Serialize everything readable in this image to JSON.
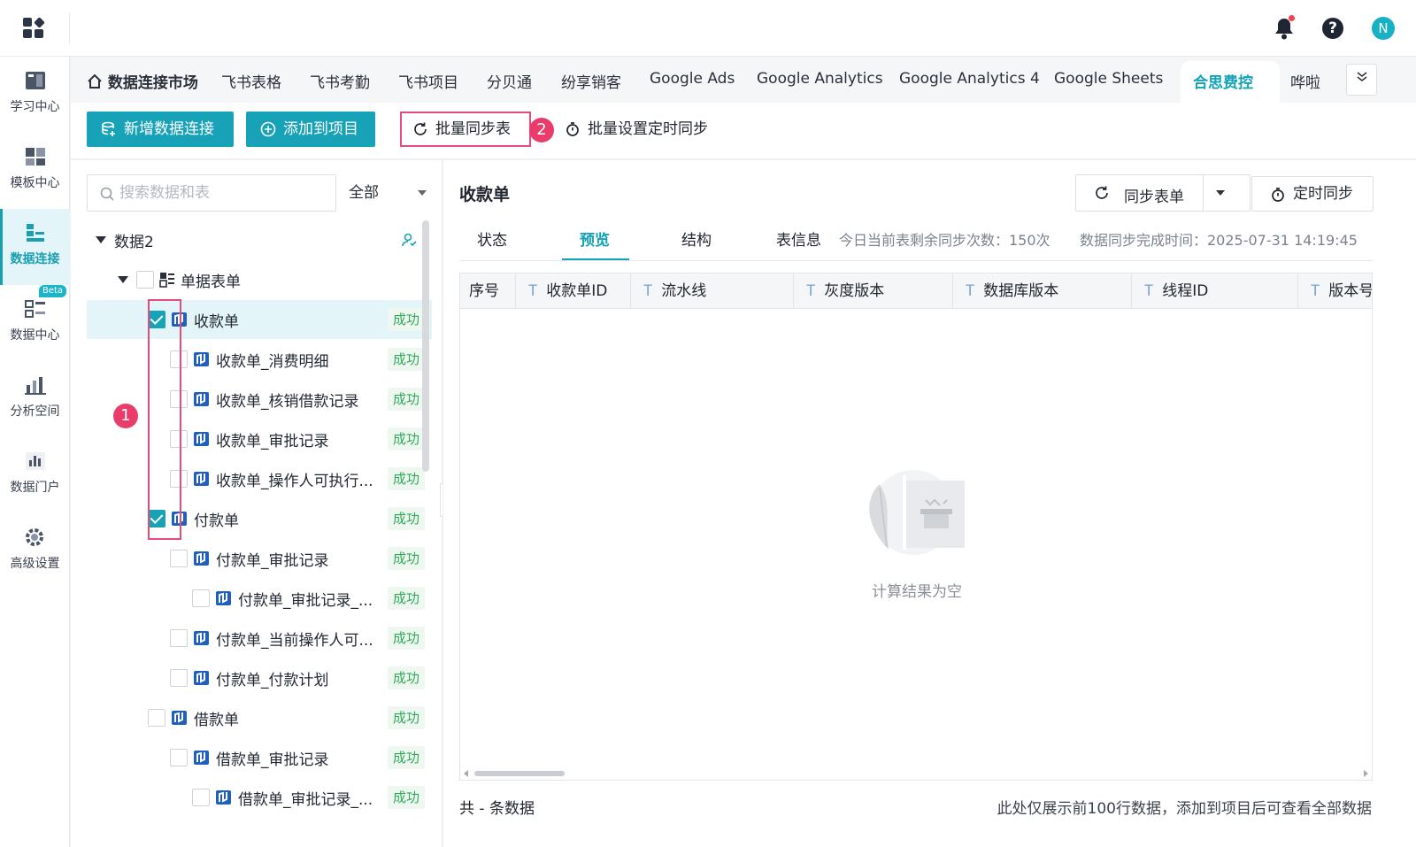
{
  "topbar": {
    "avatar_letter": "N"
  },
  "leftnav": {
    "items": [
      {
        "label": "学习中心",
        "icon": "book-icon"
      },
      {
        "label": "模板中心",
        "icon": "template-icon"
      },
      {
        "label": "数据连接",
        "icon": "data-connect-icon",
        "active": true
      },
      {
        "label": "数据中心",
        "icon": "data-center-icon",
        "badge": "Beta"
      },
      {
        "label": "分析空间",
        "icon": "analysis-icon"
      },
      {
        "label": "数据门户",
        "icon": "portal-icon"
      },
      {
        "label": "高级设置",
        "icon": "gear-icon"
      }
    ]
  },
  "tabs": {
    "home": "数据连接市场",
    "items": [
      "飞书表格",
      "飞书考勤",
      "飞书项目",
      "分贝通",
      "纷享销客",
      "Google Ads",
      "Google Analytics",
      "Google Analytics 4",
      "Google Sheets",
      "合思费控",
      "哗啦"
    ],
    "active": "合思费控"
  },
  "actions": {
    "add_connection": "新增数据连接",
    "add_to_project": "添加到项目",
    "batch_sync": "批量同步表",
    "batch_schedule": "批量设置定时同步",
    "annotation_1": "1",
    "annotation_2": "2"
  },
  "tree": {
    "search_placeholder": "搜索数据和表",
    "filter_value": "全部",
    "root": "数据2",
    "group": "单据表单",
    "status_label": "成功",
    "nodes": [
      {
        "label": "收款单",
        "checked": true,
        "selected": true
      },
      {
        "label": "收款单_消费明细",
        "checked": false
      },
      {
        "label": "收款单_核销借款记录",
        "checked": false
      },
      {
        "label": "收款单_审批记录",
        "checked": false
      },
      {
        "label": "收款单_操作人可执行...",
        "checked": false
      },
      {
        "label": "付款单",
        "checked": true
      },
      {
        "label": "付款单_审批记录",
        "checked": false
      },
      {
        "label": "付款单_审批记录_...",
        "checked": false
      },
      {
        "label": "付款单_当前操作人可...",
        "checked": false
      },
      {
        "label": "付款单_付款计划",
        "checked": false
      },
      {
        "label": "借款单",
        "checked": false
      },
      {
        "label": "借款单_审批记录",
        "checked": false
      },
      {
        "label": "借款单_审批记录_...",
        "checked": false
      }
    ]
  },
  "detail": {
    "title": "收款单",
    "sync_button": "同步表单",
    "timer_button": "定时同步",
    "subtabs": [
      "状态",
      "预览",
      "结构",
      "表信息"
    ],
    "active_subtab": "预览",
    "remaining_sync": "今日当前表剩余同步次数：150次",
    "sync_done_time": "数据同步完成时间：2025-07-31 14:19:45",
    "columns": [
      {
        "label": "序号",
        "type": ""
      },
      {
        "label": "收款单ID",
        "type": "T"
      },
      {
        "label": "流水线",
        "type": "T"
      },
      {
        "label": "灰度版本",
        "type": "T"
      },
      {
        "label": "数据库版本",
        "type": "T"
      },
      {
        "label": "线程ID",
        "type": "T"
      },
      {
        "label": "版本号",
        "type": "T"
      }
    ],
    "empty_text": "计算结果为空",
    "footer_count": "共 - 条数据",
    "footer_note": "此处仅展示前100行数据，添加到项目后可查看全部数据"
  },
  "colors": {
    "accent": "#17a2b8",
    "annotation": "#e44d79",
    "success": "#30a85a"
  }
}
